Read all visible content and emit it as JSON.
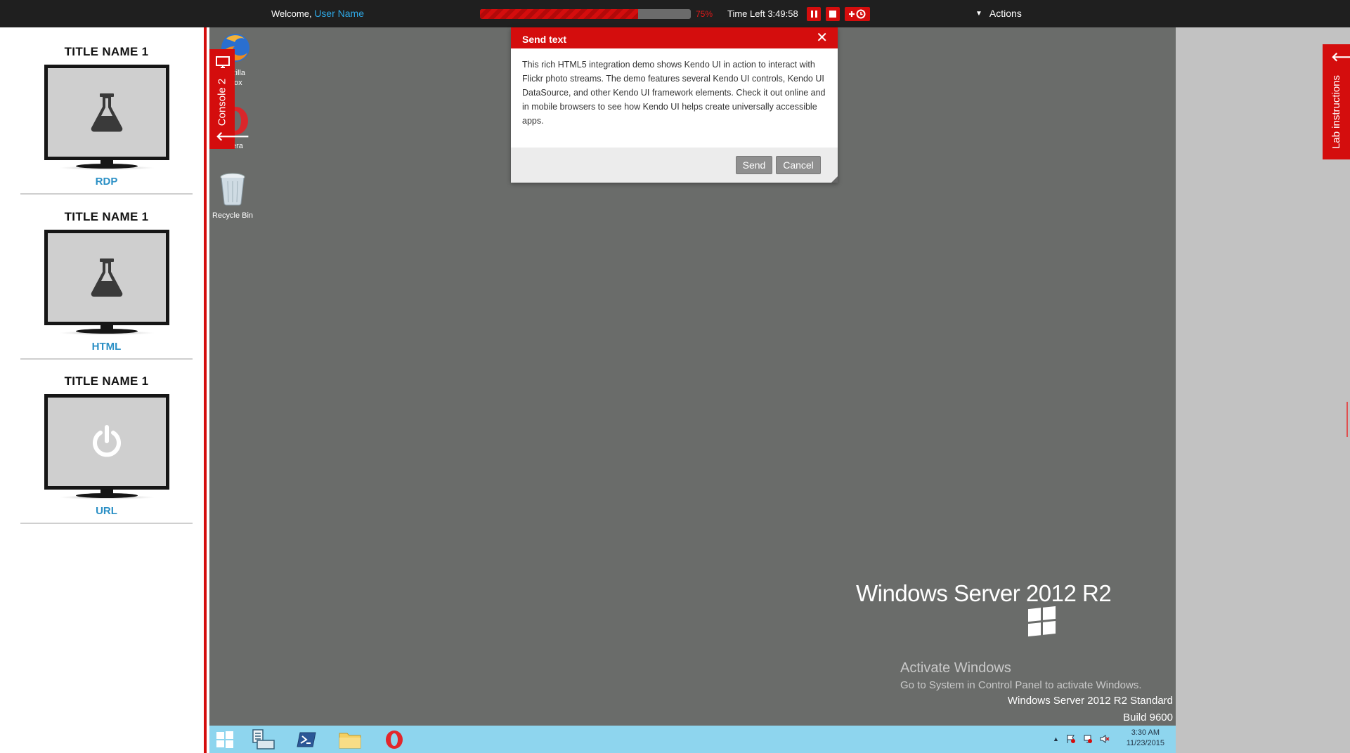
{
  "topbar": {
    "welcome_prefix": "Welcome,",
    "user_name": "User Name",
    "progress_percent": 75,
    "progress_label": "75%",
    "time_left": "Time Left 3:49:58",
    "extend_label": "+⏲",
    "actions_label": "Actions"
  },
  "sidebar": {
    "consoles": [
      {
        "title": "TITLE NAME 1",
        "label": "RDP",
        "icon": "flask-icon"
      },
      {
        "title": "TITLE NAME 1",
        "label": "HTML",
        "icon": "flask-icon"
      },
      {
        "title": "TITLE NAME 1",
        "label": "URL",
        "icon": "power-icon"
      }
    ]
  },
  "console_tab": {
    "label": "Console 2"
  },
  "desktop": {
    "icons": [
      {
        "name": "zilla\nfox",
        "icon": "firefox-icon"
      },
      {
        "name": "era",
        "icon": "opera-icon"
      },
      {
        "name": "Recycle Bin",
        "icon": "recycle-bin-icon"
      }
    ],
    "brand": "Windows Server 2012 R2",
    "activate_title": "Activate Windows",
    "activate_text": "Go to System in Control Panel to activate Windows.",
    "edition": "Windows Server 2012 R2 Standard",
    "build": "Build 9600"
  },
  "dialog": {
    "title": "Send text",
    "body": "This rich HTML5 integration demo shows Kendo UI in action to interact with Flickr photo streams. The demo features several Kendo UI controls, Kendo UI DataSource, and other Kendo UI framework elements. Check it out online and in mobile browsers to see how Kendo UI helps create universally accessible apps.",
    "send_label": "Send",
    "cancel_label": "Cancel"
  },
  "taskbar": {
    "time": "3:30 AM",
    "date": "11/23/2015"
  },
  "lab_tab": {
    "label": "Lab instructions"
  },
  "colors": {
    "accent": "#d40d0d",
    "link": "#2a8fc5",
    "desktop": "#6a6c6a",
    "taskbar": "#8ed5ee"
  }
}
